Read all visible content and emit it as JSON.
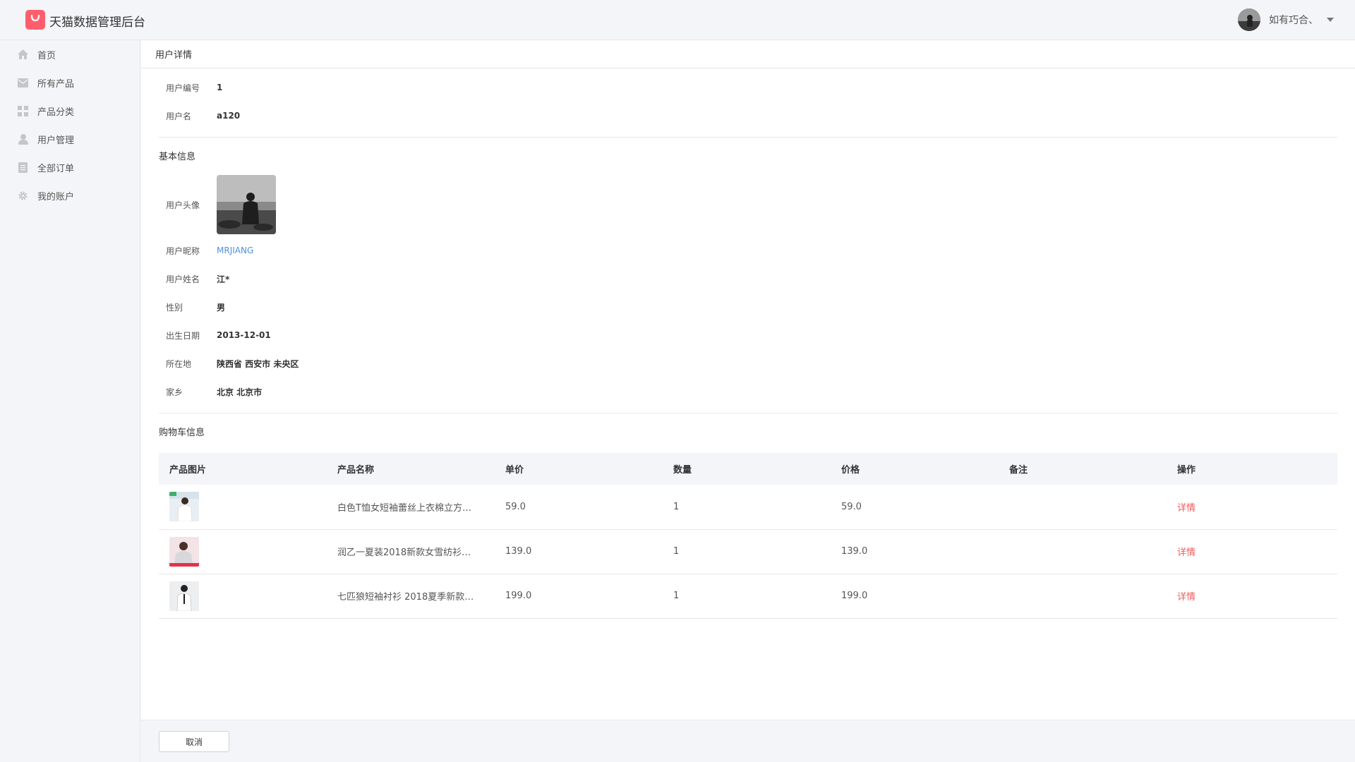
{
  "header": {
    "app_title": "天猫数据管理后台",
    "logo_icon": "shopping-bag-icon",
    "username": "如有巧合、",
    "brand_color": "#ff5f6d"
  },
  "sidebar": {
    "items": [
      {
        "label": "首页",
        "icon": "home-icon"
      },
      {
        "label": "所有产品",
        "icon": "mail-icon"
      },
      {
        "label": "产品分类",
        "icon": "grid-icon"
      },
      {
        "label": "用户管理",
        "icon": "user-icon"
      },
      {
        "label": "全部订单",
        "icon": "document-icon"
      },
      {
        "label": "我的账户",
        "icon": "gear-icon"
      }
    ]
  },
  "page": {
    "title": "用户详情"
  },
  "user": {
    "id_label": "用户编号",
    "id": "1",
    "name_label": "用户名",
    "name": "a120"
  },
  "basic_info": {
    "section_title": "基本信息",
    "avatar_label": "用户头像",
    "nickname_label": "用户昵称",
    "nickname": "MRJIANG",
    "realname_label": "用户姓名",
    "realname": "江*",
    "gender_label": "性别",
    "gender": "男",
    "birthday_label": "出生日期",
    "birthday": "2013-12-01",
    "location_label": "所在地",
    "location": "陕西省 西安市 未央区",
    "hometown_label": "家乡",
    "hometown": "北京 北京市"
  },
  "cart": {
    "section_title": "购物车信息",
    "columns": [
      "产品图片",
      "产品名称",
      "单价",
      "数量",
      "价格",
      "备注",
      "操作"
    ],
    "rows": [
      {
        "name": "白色T恤女短袖蕾丝上衣棉立方…",
        "unit_price": "59.0",
        "quantity": "1",
        "price": "59.0",
        "note": "",
        "action": "详情"
      },
      {
        "name": "润乙一夏装2018新款女雪纺衫…",
        "unit_price": "139.0",
        "quantity": "1",
        "price": "139.0",
        "note": "",
        "action": "详情"
      },
      {
        "name": "七匹狼短袖衬衫 2018夏季新款…",
        "unit_price": "199.0",
        "quantity": "1",
        "price": "199.0",
        "note": "",
        "action": "详情"
      }
    ]
  },
  "footer": {
    "cancel_label": "取消"
  }
}
